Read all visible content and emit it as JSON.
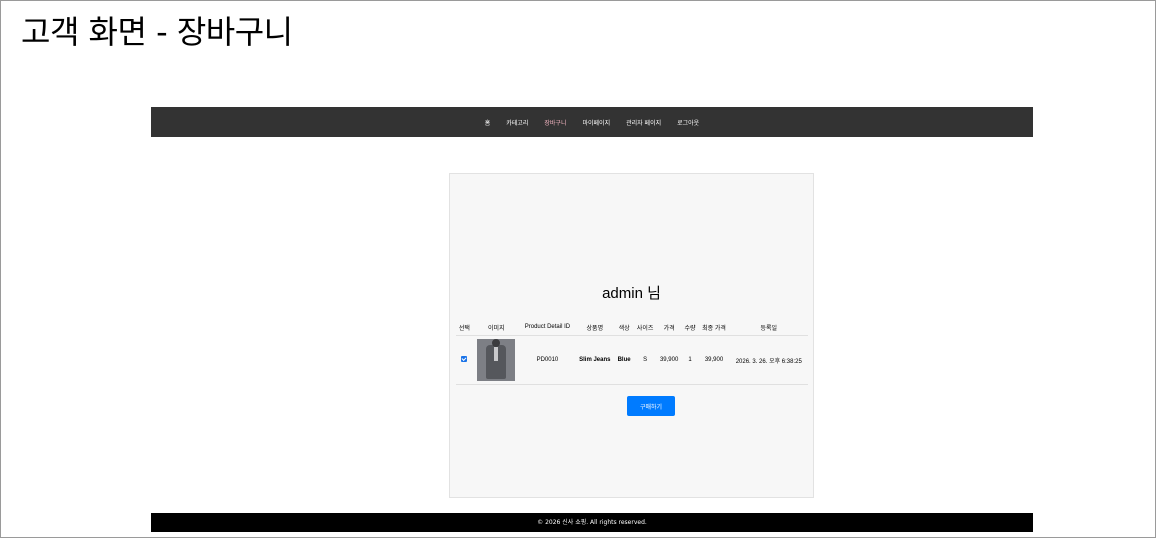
{
  "page_title": "고객 화면 - 장바구니",
  "nav": {
    "items": [
      {
        "label": "홈"
      },
      {
        "label": "카테고리"
      },
      {
        "label": "장바구니",
        "active": true
      },
      {
        "label": "마이페이지"
      },
      {
        "label": "관리자 페이지"
      },
      {
        "label": "로그아웃"
      }
    ]
  },
  "cart": {
    "greeting": "admin 님",
    "headers": [
      "선택",
      "이미지",
      "Product Detail ID",
      "상품명",
      "색상",
      "사이즈",
      "가격",
      "수량",
      "최종 가격",
      "등록일"
    ],
    "rows": [
      {
        "checked": true,
        "image_icon": "coat-product-photo",
        "product_detail_id": "PD0010",
        "name": "Slim Jeans",
        "color": "Blue",
        "size": "S",
        "price": "39,900",
        "quantity": "1",
        "final_price": "39,900",
        "registered_at": "2026. 3. 26. 오후 6:38:25"
      }
    ],
    "buy_label": "구매하기"
  },
  "footer": {
    "text": "© 2026 신사 쇼핑. All rights reserved."
  },
  "colors": {
    "navbar_bg": "#333333",
    "active_nav": "#f4b6c2",
    "buy_button": "#007bff",
    "footer_bg": "#000000",
    "panel_bg": "#f7f7f7"
  }
}
